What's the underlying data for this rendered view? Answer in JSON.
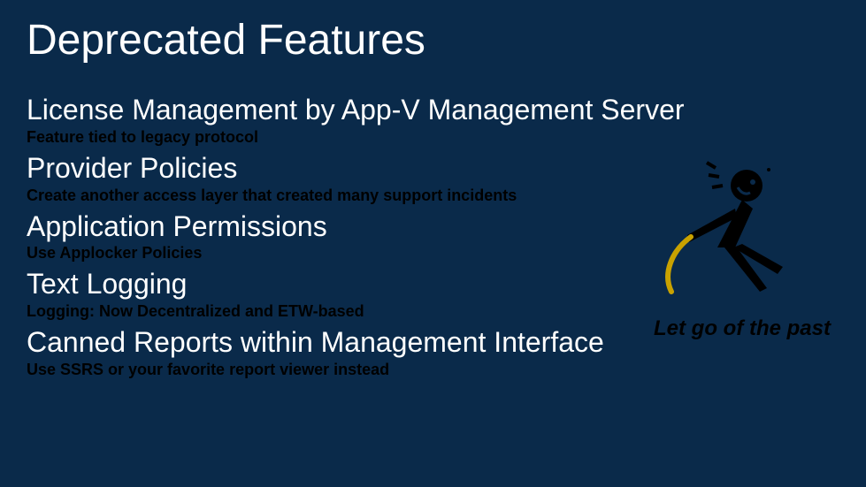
{
  "title": "Deprecated Features",
  "items": [
    {
      "heading": "License Management by App-V Management Server",
      "desc": "Feature tied to legacy protocol"
    },
    {
      "heading": "Provider Policies",
      "desc": "Create another access layer that created many support incidents"
    },
    {
      "heading": "Application Permissions",
      "desc": "Use Applocker Policies"
    },
    {
      "heading": "Text Logging",
      "desc": "Logging: Now Decentralized and ETW-based"
    },
    {
      "heading": "Canned Reports within Management Interface",
      "desc": "Use SSRS or your favorite report viewer instead"
    }
  ],
  "caption": "Let go of the past"
}
